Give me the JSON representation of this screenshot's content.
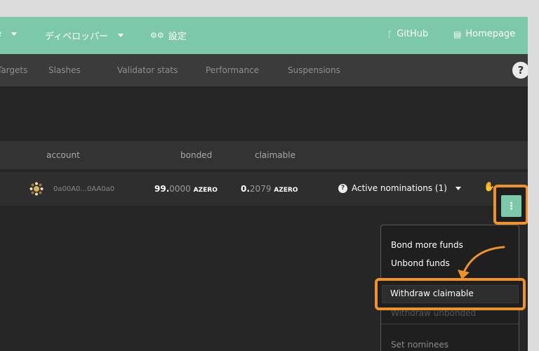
{
  "topnav": {
    "more_label": "e",
    "developer_label": "ディベロッパー",
    "settings_label": "設定",
    "github_label": "GitHub",
    "homepage_label": "Homepage"
  },
  "subnav": {
    "tabs": [
      "Targets",
      "Slashes",
      "Validator stats",
      "Performance",
      "Suspensions"
    ],
    "help_label": "?"
  },
  "table": {
    "headers": {
      "account": "account",
      "bonded": "bonded",
      "claimable": "claimable"
    },
    "row": {
      "account": "0a00A0...0AA0a0",
      "bonded_int": "99.",
      "bonded_dec": "0000",
      "claimable_int": "0.",
      "claimable_dec": "2079",
      "unit": "AZERO",
      "nominations": "Active nominations (1)"
    }
  },
  "menu": {
    "button_label": "⋮",
    "items": [
      "Bond more funds",
      "Unbond funds",
      "Withdraw claimable",
      "Withdraw unbonded",
      "Set nominees"
    ]
  },
  "colors": {
    "accent": "#7dc8ab",
    "highlight": "#f0922b"
  }
}
